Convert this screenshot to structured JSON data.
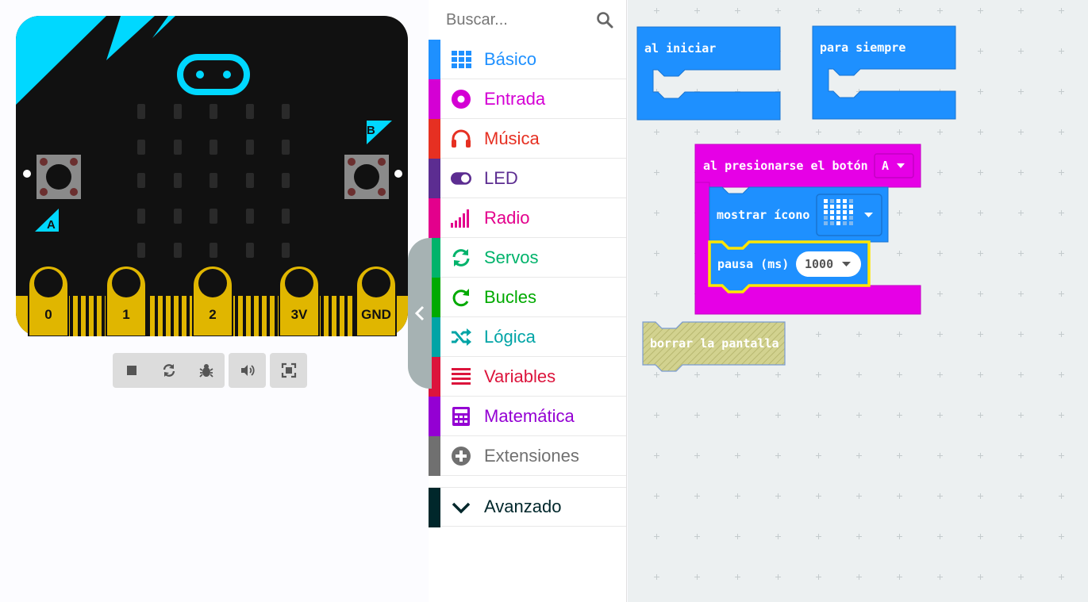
{
  "simulator": {
    "pins": [
      "0",
      "1",
      "2",
      "3V",
      "GND"
    ],
    "button_a_label": "A",
    "button_b_label": "B",
    "toolbar": [
      "stop-icon",
      "restart-icon",
      "debug-icon",
      "mute-icon",
      "fullscreen-icon"
    ]
  },
  "toolbox": {
    "search_placeholder": "Buscar...",
    "categories": [
      {
        "label": "Básico",
        "color": "#1e90ff",
        "icon": "grid-icon"
      },
      {
        "label": "Entrada",
        "color": "#d400d4",
        "icon": "target-icon"
      },
      {
        "label": "Música",
        "color": "#e63022",
        "icon": "headphones-icon"
      },
      {
        "label": "LED",
        "color": "#5c2d91",
        "icon": "toggle-icon"
      },
      {
        "label": "Radio",
        "color": "#e3008c",
        "icon": "signal-bars-icon"
      },
      {
        "label": "Servos",
        "color": "#00a4a6",
        "icon": "refresh-icon"
      },
      {
        "label": "Bucles",
        "color": "#00aa00",
        "icon": "loop-icon"
      },
      {
        "label": "Lógica",
        "color": "#00a4a6",
        "icon": "shuffle-icon"
      },
      {
        "label": "Variables",
        "color": "#dc143c",
        "icon": "list-icon"
      },
      {
        "label": "Matemática",
        "color": "#9400d3",
        "icon": "calculator-icon"
      },
      {
        "label": "Extensiones",
        "color": "#707070",
        "icon": "plus-circle-icon"
      }
    ],
    "advanced_label": "Avanzado",
    "advanced_color": "#00272b"
  },
  "workspace": {
    "on_start": "al iniciar",
    "forever": "para siempre",
    "on_button": "al presionarse el botón",
    "button_value": "A",
    "show_icon": "mostrar ícono",
    "pause": "pausa (ms)",
    "pause_value": "1000",
    "clear_screen": "borrar la pantalla"
  }
}
